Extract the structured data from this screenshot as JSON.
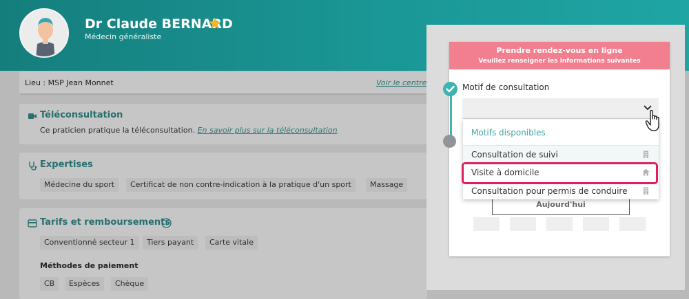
{
  "doctor": {
    "name": "Dr Claude BERNARD",
    "specialty": "Médecin généraliste"
  },
  "location": {
    "label": "Lieu : MSP Jean Monnet",
    "link": "Voir le centre"
  },
  "teleconsultation": {
    "title": "Téléconsultation",
    "text": "Ce praticien pratique la téléconsultation.",
    "link": "En savoir plus sur la téléconsultation"
  },
  "expertises": {
    "title": "Expertises",
    "chips": [
      "Médecine du sport",
      "Certificat de non contre-indication à la pratique d'un sport",
      "Massage"
    ]
  },
  "tarifs": {
    "title": "Tarifs et remboursements",
    "chips": [
      "Conventionné secteur 1",
      "Tiers payant",
      "Carte vitale"
    ],
    "payment_title": "Méthodes de paiement",
    "payment_chips": [
      "CB",
      "Espèces",
      "Chèque"
    ]
  },
  "booking": {
    "title": "Prendre rendez-vous en ligne",
    "subtitle": "Veuillez renseigner les informations suivantes",
    "motif_label": "Motif de consultation",
    "today_button": "Aujourd'hui",
    "dropdown": {
      "header": "Motifs disponibles",
      "options": [
        {
          "label": "Consultation de suivi",
          "icon": "building-icon"
        },
        {
          "label": "Visite à domicile",
          "icon": "home-icon"
        },
        {
          "label": "Consultation pour permis de conduire",
          "icon": "building-icon"
        }
      ]
    }
  },
  "colors": {
    "header_teal": "#1a9796",
    "booking_pink": "#f27f8f",
    "highlight": "#e01d5e"
  }
}
